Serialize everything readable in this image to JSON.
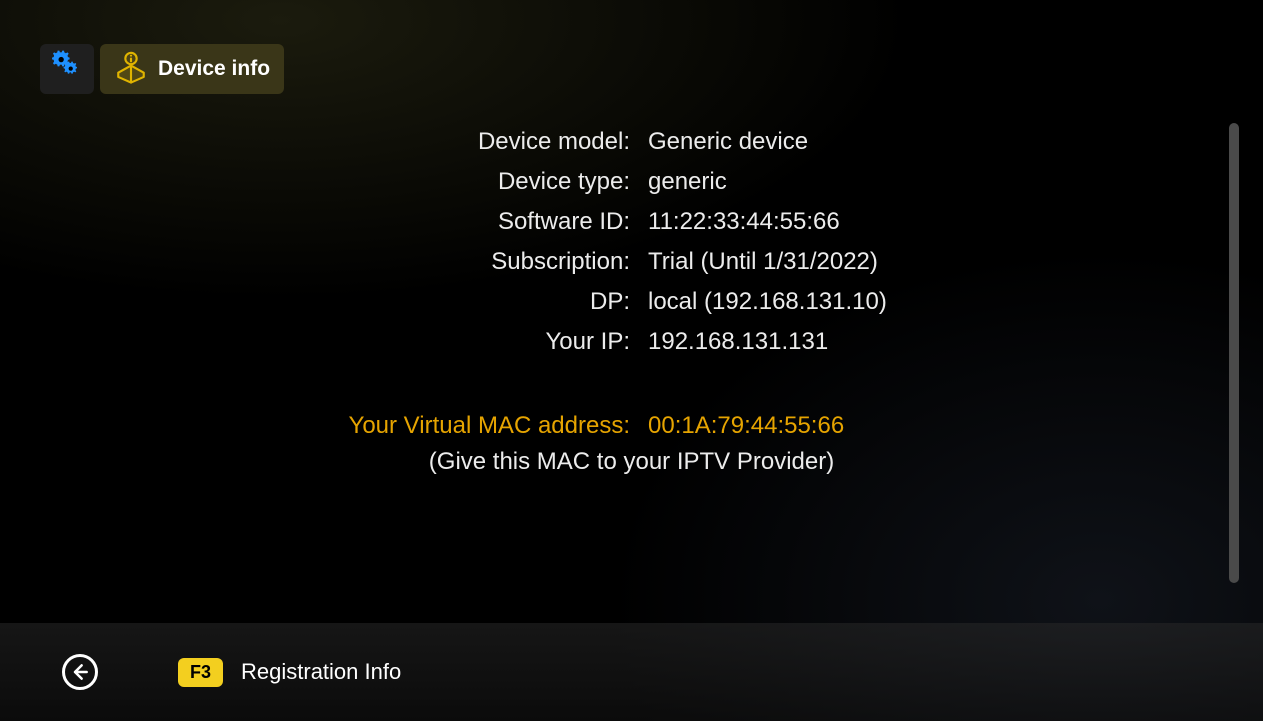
{
  "tabs": {
    "device_info_label": "Device info"
  },
  "info": {
    "device_model": {
      "label": "Device model:",
      "value": "Generic device"
    },
    "device_type": {
      "label": "Device type:",
      "value": "generic"
    },
    "software_id": {
      "label": "Software ID:",
      "value": "11:22:33:44:55:66"
    },
    "subscription": {
      "label": "Subscription:",
      "value": "Trial (Until 1/31/2022)"
    },
    "dp": {
      "label": "DP:",
      "value": "local (192.168.131.10)"
    },
    "your_ip": {
      "label": "Your IP:",
      "value": "192.168.131.131"
    },
    "virtual_mac": {
      "label": "Your Virtual MAC address:",
      "value": "00:1A:79:44:55:66"
    },
    "note": "(Give this MAC to your IPTV Provider)"
  },
  "bottom": {
    "f3_key": "F3",
    "f3_label": "Registration Info"
  }
}
